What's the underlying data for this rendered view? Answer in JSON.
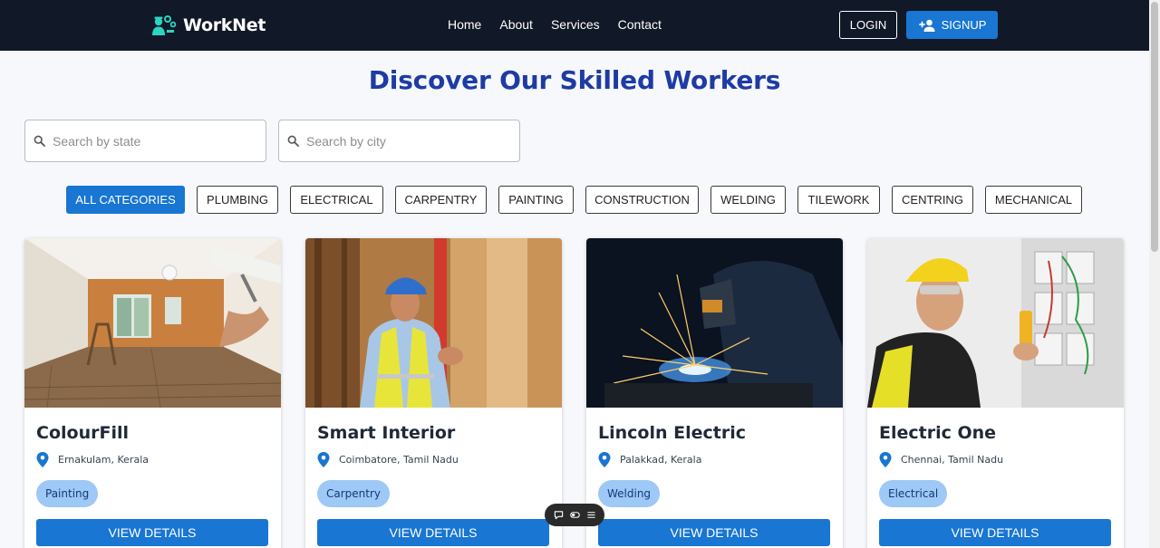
{
  "brand": {
    "name": "WorkNet",
    "icon": "workers-gear-icon",
    "accent": "#2dd4bf"
  },
  "nav": {
    "links": [
      {
        "label": "Home"
      },
      {
        "label": "About"
      },
      {
        "label": "Services"
      },
      {
        "label": "Contact"
      }
    ],
    "login_label": "LOGIN",
    "signup_label": "SIGNUP"
  },
  "page": {
    "title": "Discover Our Skilled Workers"
  },
  "search": {
    "state_placeholder": "Search by state",
    "city_placeholder": "Search by city"
  },
  "categories": {
    "selected": "ALL CATEGORIES",
    "items": [
      {
        "label": "ALL CATEGORIES"
      },
      {
        "label": "PLUMBING"
      },
      {
        "label": "ELECTRICAL"
      },
      {
        "label": "CARPENTRY"
      },
      {
        "label": "PAINTING"
      },
      {
        "label": "CONSTRUCTION"
      },
      {
        "label": "WELDING"
      },
      {
        "label": "TILEWORK"
      },
      {
        "label": "CENTRING"
      },
      {
        "label": "MECHANICAL"
      }
    ]
  },
  "workers": [
    {
      "name": "ColourFill",
      "location": "Ernakulam, Kerala",
      "category": "Painting",
      "button": "VIEW DETAILS",
      "image": "painting-room-photo"
    },
    {
      "name": "Smart Interior",
      "location": "Coimbatore, Tamil Nadu",
      "category": "Carpentry",
      "button": "VIEW DETAILS",
      "image": "carpenter-photo"
    },
    {
      "name": "Lincoln Electric",
      "location": "Palakkad, Kerala",
      "category": "Welding",
      "button": "VIEW DETAILS",
      "image": "welder-photo"
    },
    {
      "name": "Electric One",
      "location": "Chennai, Tamil Nadu",
      "category": "Electrical",
      "button": "VIEW DETAILS",
      "image": "electrician-photo"
    }
  ],
  "colors": {
    "nav_bg": "#111827",
    "primary": "#1976d2",
    "title": "#1e3ba5",
    "tag_bg": "#9ec8f5"
  },
  "floating_toolbar": {
    "icons": [
      "comment-icon",
      "toggle-icon",
      "menu-icon"
    ]
  }
}
